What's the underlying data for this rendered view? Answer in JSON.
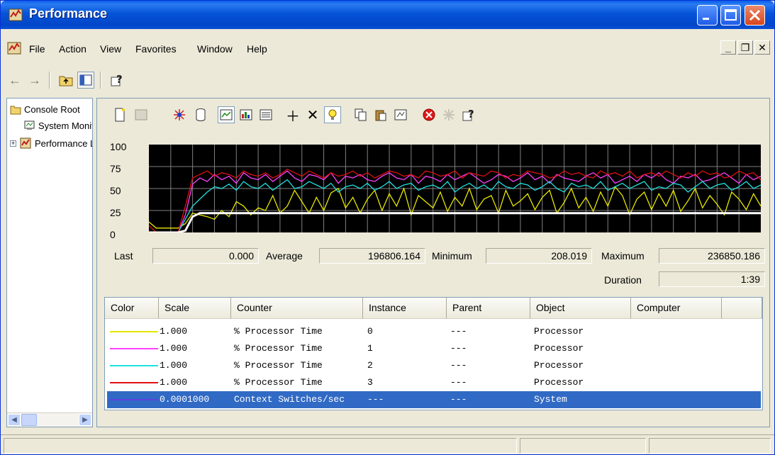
{
  "window": {
    "title": "Performance"
  },
  "menu": [
    "File",
    "Action",
    "View",
    "Favorites",
    "Window",
    "Help"
  ],
  "tree": {
    "items": [
      {
        "label": "Console Root"
      },
      {
        "label": "System Monitor"
      },
      {
        "label": "Performance Logs and Alerts"
      }
    ]
  },
  "chart": {
    "yticks": [
      "100",
      "75",
      "50",
      "25",
      "0"
    ]
  },
  "chart_data": {
    "type": "line",
    "ylim": [
      0,
      100
    ],
    "grid": true,
    "series": [
      {
        "name": "% Processor Time 0",
        "color": "#e6e600",
        "values": [
          12,
          5,
          5,
          5,
          5,
          10,
          22,
          20,
          18,
          15,
          25,
          18,
          35,
          30,
          20,
          28,
          25,
          42,
          22,
          30,
          48,
          35,
          22,
          40,
          25,
          45,
          50,
          28,
          40,
          22,
          38,
          48,
          25,
          44,
          30,
          50,
          20,
          42,
          35,
          28,
          46,
          24,
          40,
          30,
          50,
          26,
          38,
          42,
          22,
          48,
          30,
          36,
          44,
          26,
          40,
          48,
          22,
          34,
          50,
          28,
          40,
          24,
          46,
          30,
          52,
          42,
          20,
          38,
          46,
          26,
          44,
          30,
          48,
          24,
          36,
          50,
          28,
          42,
          32,
          20,
          46,
          38,
          26,
          44,
          30
        ]
      },
      {
        "name": "% Processor Time 1",
        "color": "#ff40ff",
        "values": [
          0,
          0,
          0,
          0,
          0,
          20,
          55,
          62,
          58,
          66,
          60,
          64,
          56,
          68,
          62,
          60,
          66,
          58,
          64,
          70,
          62,
          58,
          66,
          64,
          60,
          68,
          56,
          64,
          62,
          66,
          60,
          58,
          64,
          68,
          62,
          60,
          66,
          56,
          64,
          62,
          58,
          66,
          60,
          64,
          68,
          62,
          56,
          60,
          66,
          64,
          58,
          62,
          68,
          60,
          64,
          56,
          66,
          62,
          60,
          58,
          64,
          68,
          62,
          66,
          56,
          60,
          64,
          58,
          66,
          62,
          68,
          60,
          56,
          64,
          62,
          66,
          58,
          60,
          64,
          68,
          62,
          56,
          66,
          60,
          64
        ]
      },
      {
        "name": "% Processor Time 2",
        "color": "#20e0e0",
        "values": [
          0,
          0,
          0,
          0,
          0,
          15,
          30,
          38,
          46,
          52,
          50,
          55,
          48,
          58,
          52,
          50,
          56,
          48,
          54,
          60,
          50,
          52,
          58,
          54,
          50,
          56,
          46,
          52,
          54,
          50,
          56,
          48,
          52,
          58,
          50,
          54,
          56,
          48,
          52,
          54,
          50,
          58,
          46,
          52,
          56,
          50,
          54,
          48,
          58,
          52,
          50,
          56,
          54,
          48,
          52,
          58,
          50,
          46,
          56,
          52,
          54,
          50,
          58,
          48,
          52,
          56,
          50,
          54,
          58,
          48,
          52,
          50,
          56,
          54,
          46,
          52,
          58,
          50,
          54,
          56,
          48,
          52,
          58,
          50,
          54
        ]
      },
      {
        "name": "% Processor Time 3",
        "color": "#e01010",
        "values": [
          8,
          0,
          0,
          0,
          0,
          30,
          62,
          66,
          70,
          64,
          68,
          66,
          62,
          70,
          66,
          64,
          68,
          62,
          66,
          72,
          68,
          64,
          70,
          66,
          62,
          68,
          64,
          66,
          70,
          64,
          68,
          62,
          66,
          70,
          68,
          64,
          66,
          62,
          70,
          68,
          64,
          66,
          70,
          62,
          68,
          66,
          64,
          70,
          68,
          62,
          66,
          64,
          70,
          68,
          66,
          62,
          64,
          70,
          66,
          68,
          64,
          62,
          70,
          66,
          68,
          64,
          70,
          62,
          66,
          68,
          64,
          70,
          66,
          62,
          68,
          64,
          70,
          66,
          68,
          62,
          64,
          70,
          66,
          68,
          60
        ]
      },
      {
        "name": "Context Switches/sec",
        "color": "#ffffff",
        "values": [
          0,
          0,
          0,
          0,
          0,
          2,
          18,
          22,
          22,
          22,
          22,
          22,
          22,
          22,
          22,
          22,
          22,
          22,
          22,
          22,
          22,
          22,
          22,
          22,
          22,
          22,
          22,
          22,
          22,
          22,
          22,
          22,
          22,
          22,
          22,
          22,
          22,
          22,
          22,
          22,
          22,
          22,
          22,
          22,
          22,
          22,
          22,
          22,
          22,
          22,
          22,
          22,
          22,
          22,
          22,
          22,
          22,
          22,
          22,
          22,
          22,
          22,
          22,
          22,
          22,
          22,
          22,
          22,
          22,
          22,
          22,
          22,
          22,
          22,
          22,
          22,
          22,
          22,
          22,
          22,
          22,
          22,
          22,
          22,
          22
        ]
      }
    ]
  },
  "stats": {
    "last_label": "Last",
    "last": "0.000",
    "average_label": "Average",
    "average": "196806.164",
    "minimum_label": "Minimum",
    "minimum": "208.019",
    "maximum_label": "Maximum",
    "maximum": "236850.186",
    "duration_label": "Duration",
    "duration": "1:39"
  },
  "columns": [
    "Color",
    "Scale",
    "Counter",
    "Instance",
    "Parent",
    "Object",
    "Computer"
  ],
  "rows": [
    {
      "color": "#e6e600",
      "scale": "1.000",
      "counter": "% Processor Time",
      "instance": "0",
      "parent": "---",
      "object": "Processor"
    },
    {
      "color": "#ff40ff",
      "scale": "1.000",
      "counter": "% Processor Time",
      "instance": "1",
      "parent": "---",
      "object": "Processor"
    },
    {
      "color": "#20e0e0",
      "scale": "1.000",
      "counter": "% Processor Time",
      "instance": "2",
      "parent": "---",
      "object": "Processor"
    },
    {
      "color": "#e01010",
      "scale": "1.000",
      "counter": "% Processor Time",
      "instance": "3",
      "parent": "---",
      "object": "Processor"
    },
    {
      "color": "#6040e0",
      "scale": "0.0001000",
      "counter": "Context Switches/sec",
      "instance": "---",
      "parent": "---",
      "object": "System"
    }
  ]
}
